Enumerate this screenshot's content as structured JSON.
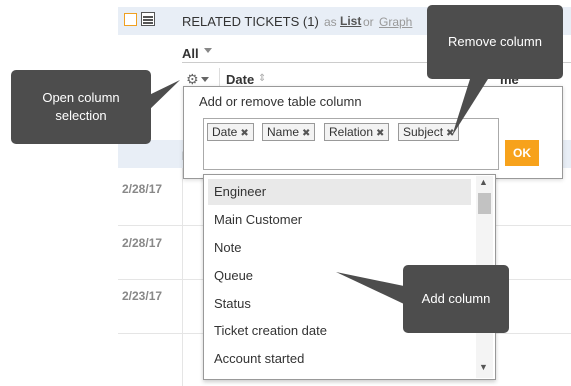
{
  "header": {
    "title": "RELATED TICKETS (1)",
    "as_text": "as",
    "list_link": "List",
    "or_text": "or",
    "graph_link": "Graph"
  },
  "filter": {
    "label": "All"
  },
  "table": {
    "columns": [
      "Date",
      "Name"
    ],
    "name_column_partial": "me",
    "group_label": "I",
    "row_dates": [
      "2/28/17",
      "2/28/17",
      "2/23/17"
    ]
  },
  "popup": {
    "title": "Add or remove table column",
    "selected_columns": [
      "Date",
      "Name",
      "Relation",
      "Subject"
    ],
    "remove_glyph": "✖",
    "ok_label": "OK"
  },
  "available_columns": [
    "Engineer",
    "Main Customer",
    "Note",
    "Queue",
    "Status",
    "Ticket creation date",
    "Account started"
  ],
  "callouts": {
    "open_column_selection": "Open column selection",
    "remove_column": "Remove column",
    "add_column": "Add column"
  },
  "colors": {
    "accent": "#f7a21b",
    "callout_bg": "#4d4d4d",
    "header_band": "#e8eef6"
  }
}
